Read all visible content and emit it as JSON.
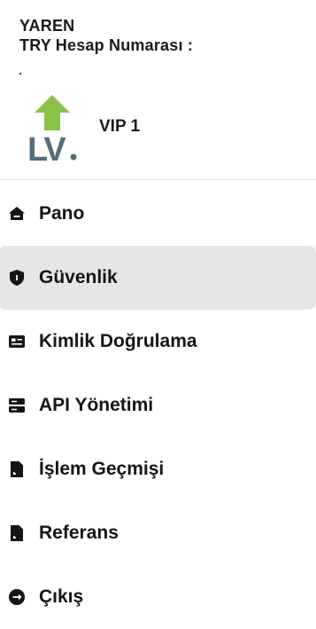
{
  "user": {
    "name": "YAREN",
    "account_label": "TRY Hesap Numarası :"
  },
  "level": {
    "logo_alt": "LV.",
    "label": "VIP 1",
    "logo_arrow_color": "#8bc34a",
    "logo_text_color": "#546e7a"
  },
  "menu": {
    "items": [
      {
        "label": "Pano",
        "icon": "home-icon"
      },
      {
        "label": "Güvenlik",
        "icon": "shield-icon",
        "active": true
      },
      {
        "label": "Kimlik Doğrulama",
        "icon": "id-card-icon"
      },
      {
        "label": "API Yönetimi",
        "icon": "server-icon"
      },
      {
        "label": "İşlem Geçmişi",
        "icon": "document-icon"
      },
      {
        "label": "Referans",
        "icon": "document-icon"
      },
      {
        "label": "Çıkış",
        "icon": "logout-icon"
      }
    ]
  },
  "colors": {
    "active_bg": "#e6e6e6",
    "text": "#151515",
    "divider": "#e3e3e3"
  }
}
